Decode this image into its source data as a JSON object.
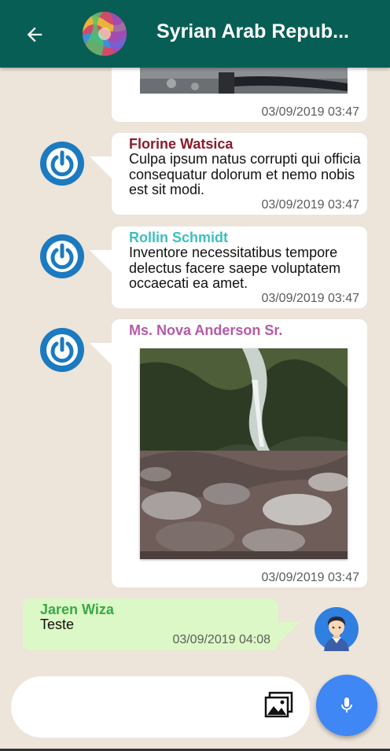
{
  "header": {
    "title": "Syrian Arab Repub...",
    "back_icon": "arrow-left-icon",
    "avatar_icon": "group-avatar-image",
    "bg_color": "#075e54"
  },
  "messages": [
    {
      "time": "03/09/2019 03:47",
      "type": "image"
    },
    {
      "sender": "Florine Watsica",
      "sender_color": "#8b1a2b",
      "body": "Culpa ipsum natus corrupti qui officia consequatur dolorum et nemo nobis est sit modi.",
      "time": "03/09/2019 03:47"
    },
    {
      "sender": "Rollin Schmidt",
      "sender_color": "#3cbfbe",
      "body": "Inventore necessitatibus tempore delectus facere saepe voluptatem occaecati ea amet.",
      "time": "03/09/2019 03:47"
    },
    {
      "sender": "Ms. Nova Anderson Sr.",
      "sender_color": "#b55aa8",
      "type": "image",
      "time": "03/09/2019 03:47"
    },
    {
      "sender": "Jaren Wiza",
      "sender_color": "#3aa84a",
      "body": "Teste",
      "time": "03/09/2019 04:08",
      "outgoing": true
    }
  ],
  "composer": {
    "placeholder": "",
    "gallery_icon": "gallery-icon",
    "mic_icon": "microphone-icon",
    "mic_color": "#3e87f5"
  }
}
